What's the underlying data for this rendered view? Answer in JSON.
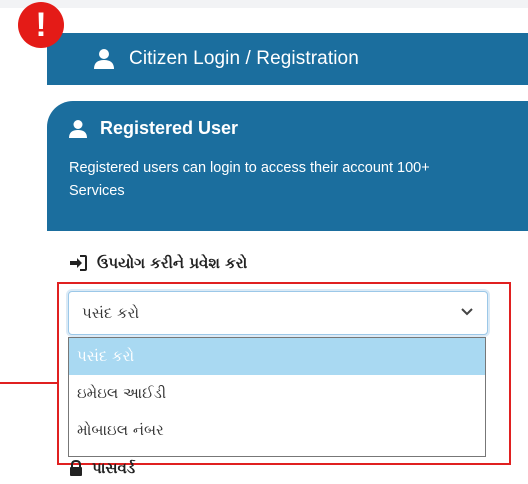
{
  "alert": {
    "symbol": "!",
    "color": "#e41b17"
  },
  "header": {
    "title": "Citizen Login / Registration",
    "icon": "user-icon",
    "bg": "#1b6e9e"
  },
  "registered": {
    "title": "Registered User",
    "description": "Registered users can login to access their account 100+ Services",
    "icon": "user-icon"
  },
  "login_method": {
    "label": "ઉપયોગ કરીને પ્રવેશ કરો",
    "icon": "sign-in-icon",
    "select_value": "પસંદ કરો",
    "options": [
      "પસંદ કરો",
      "ઇમેઇલ આઈડી",
      "મોબાઇલ નંબર"
    ],
    "highlight_color": "#e02020"
  },
  "password": {
    "label": "પાસવર્ડ",
    "icon": "lock-icon"
  }
}
